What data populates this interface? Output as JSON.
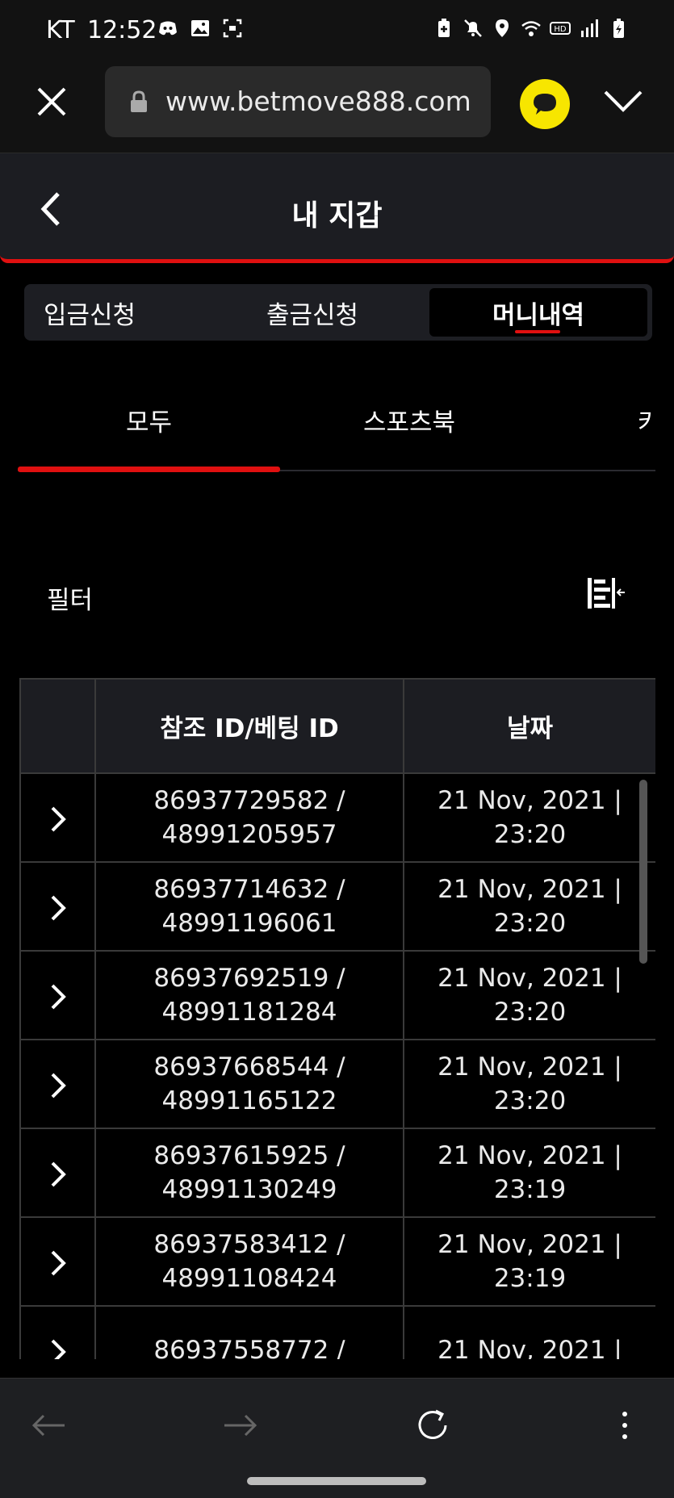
{
  "status_bar": {
    "carrier": "KT",
    "time": "12:52",
    "left_icons": [
      "discord-icon",
      "gallery-icon",
      "screenshot-icon"
    ],
    "right_icons": [
      "battery-saver-icon",
      "mute-icon",
      "location-icon",
      "wifi-icon",
      "hd-icon",
      "signal-icon",
      "battery-icon"
    ]
  },
  "browser": {
    "url": "www.betmove888.com",
    "kakao_color": "#f7e600"
  },
  "header": {
    "title": "내 지갑"
  },
  "wallet_tabs": [
    {
      "label": "입금신청",
      "active": false
    },
    {
      "label": "출금신청",
      "active": false
    },
    {
      "label": "머니내역",
      "active": true
    }
  ],
  "sub_tabs": [
    {
      "label": "모두",
      "active": true
    },
    {
      "label": "스포츠북",
      "active": false
    },
    {
      "label": "카",
      "active": false
    }
  ],
  "filter": {
    "label": "필터"
  },
  "table": {
    "headers": [
      "",
      "참조 ID/베팅 ID",
      "날짜"
    ],
    "rows": [
      {
        "ref_id": "86937729582 /",
        "bet_id": "48991205957",
        "date": "21 Nov, 2021 |",
        "time": "23:20"
      },
      {
        "ref_id": "86937714632 /",
        "bet_id": "48991196061",
        "date": "21 Nov, 2021 |",
        "time": "23:20"
      },
      {
        "ref_id": "86937692519 /",
        "bet_id": "48991181284",
        "date": "21 Nov, 2021 |",
        "time": "23:20"
      },
      {
        "ref_id": "86937668544 /",
        "bet_id": "48991165122",
        "date": "21 Nov, 2021 |",
        "time": "23:20"
      },
      {
        "ref_id": "86937615925 /",
        "bet_id": "48991130249",
        "date": "21 Nov, 2021 |",
        "time": "23:19"
      },
      {
        "ref_id": "86937583412 /",
        "bet_id": "48991108424",
        "date": "21 Nov, 2021 |",
        "time": "23:19"
      },
      {
        "ref_id": "86937558772 /",
        "bet_id": "",
        "date": "21 Nov, 2021 |",
        "time": ""
      }
    ]
  },
  "colors": {
    "accent": "#e01010",
    "background": "#000000",
    "panel": "#1c1d22"
  }
}
